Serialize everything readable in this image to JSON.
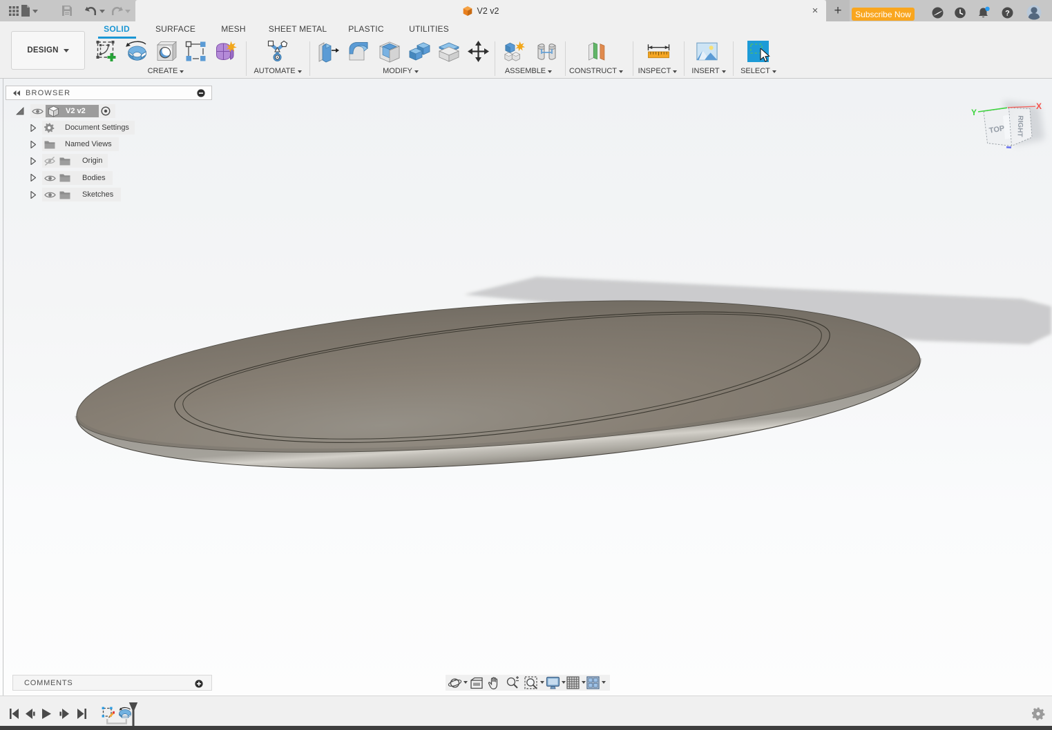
{
  "window": {
    "title": "V2 v2",
    "subscribe_label": "Subscribe Now",
    "close_glyph": "×",
    "new_tab_glyph": "+",
    "help_glyph": "?"
  },
  "ribbon": {
    "workspace_label": "DESIGN",
    "tabs": [
      {
        "label": "SOLID",
        "active": true
      },
      {
        "label": "SURFACE",
        "active": false
      },
      {
        "label": "MESH",
        "active": false
      },
      {
        "label": "SHEET METAL",
        "active": false
      },
      {
        "label": "PLASTIC",
        "active": false
      },
      {
        "label": "UTILITIES",
        "active": false
      }
    ],
    "groups": [
      {
        "label": "CREATE",
        "icons": [
          "create-sketch-icon",
          "revolve-icon",
          "hole-icon",
          "pattern-icon",
          "create-form-icon"
        ]
      },
      {
        "label": "AUTOMATE",
        "icons": [
          "automate-icon"
        ]
      },
      {
        "label": "MODIFY",
        "icons": [
          "press-pull-icon",
          "fillet-icon",
          "shell-icon",
          "combine-icon",
          "split-body-icon",
          "move-icon"
        ]
      },
      {
        "label": "ASSEMBLE",
        "icons": [
          "new-component-icon",
          "joint-icon"
        ]
      },
      {
        "label": "CONSTRUCT",
        "icons": [
          "construction-plane-icon"
        ]
      },
      {
        "label": "INSPECT",
        "icons": [
          "measure-icon"
        ]
      },
      {
        "label": "INSERT",
        "icons": [
          "insert-image-icon"
        ]
      },
      {
        "label": "SELECT",
        "icons": [
          "select-icon"
        ]
      }
    ]
  },
  "browser": {
    "title": "BROWSER",
    "root": {
      "label": "V2 v2"
    },
    "items": [
      {
        "label": "Document Settings",
        "icon": "gear-icon",
        "visibility": null
      },
      {
        "label": "Named Views",
        "icon": "folder-icon",
        "visibility": null
      },
      {
        "label": "Origin",
        "icon": "folder-icon",
        "visibility": "hidden"
      },
      {
        "label": "Bodies",
        "icon": "folder-icon",
        "visibility": "visible"
      },
      {
        "label": "Sketches",
        "icon": "folder-icon",
        "visibility": "visible"
      }
    ]
  },
  "viewcube": {
    "top_label": "TOP",
    "right_label": "RIGHT",
    "axis_x": "X",
    "axis_y": "Y"
  },
  "comments": {
    "label": "COMMENTS"
  },
  "timeline": {
    "playback": [
      "skip-to-start",
      "step-back",
      "play",
      "step-forward",
      "skip-to-end"
    ],
    "features": [
      "sketch-feature",
      "revolve-feature"
    ]
  },
  "navbar_icons": [
    "orbit",
    "look-at",
    "pan",
    "zoom",
    "fit",
    "display-settings",
    "grid",
    "viewports"
  ],
  "colors": {
    "accent_blue": "#1a96d4",
    "subscribe_orange": "#f9a61f",
    "titlebar_gray": "#c7c7c7",
    "ribbon_gray": "#f0f0f0",
    "select_blue": "#1d9bd7",
    "body_gray": "#8b867b",
    "notification_blue": "#2a9df4"
  }
}
